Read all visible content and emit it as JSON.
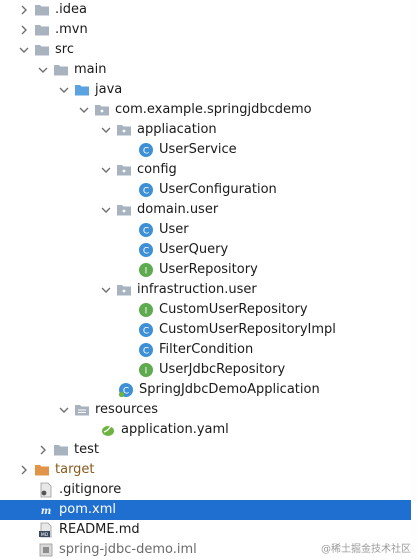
{
  "tree": {
    "idea": ".idea",
    "mvn": ".mvn",
    "src": "src",
    "main": "main",
    "java": "java",
    "package": "com.example.springjdbcdemo",
    "appliacation": "appliacation",
    "user_service": "UserService",
    "config": "config",
    "user_configuration": "UserConfiguration",
    "domain_user": "domain.user",
    "user": "User",
    "user_query": "UserQuery",
    "user_repository": "UserRepository",
    "infrastruction_user": "infrastruction.user",
    "custom_user_repository": "CustomUserRepository",
    "custom_user_repository_impl": "CustomUserRepositoryImpl",
    "filter_condition": "FilterCondition",
    "user_jdbc_repository": "UserJdbcRepository",
    "app_class": "SpringJdbcDemoApplication",
    "resources": "resources",
    "application_yaml": "application.yaml",
    "test": "test",
    "target": "target",
    "gitignore": ".gitignore",
    "pom": "pom.xml",
    "readme": "README.md",
    "iml": "spring-jdbc-demo.iml"
  },
  "watermark": "@稀土掘金技术社区",
  "colors": {
    "selection": "#1f6fd1",
    "folder": "#a8b3bf",
    "source_folder": "#5aa2e0",
    "class_icon": "#3d8fd6",
    "interface_icon": "#5eaa4f",
    "target_folder": "#e2954a"
  },
  "icons": {
    "folder": "folder-icon",
    "class": "class-icon",
    "interface": "interface-icon"
  }
}
